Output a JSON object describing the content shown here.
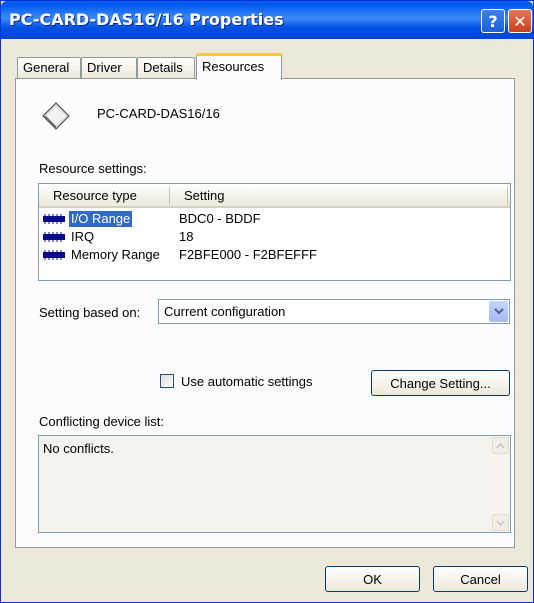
{
  "window": {
    "title": "PC-CARD-DAS16/16 Properties",
    "help_glyph": "?",
    "close_glyph": "✕"
  },
  "tabs": [
    {
      "label": "General",
      "active": false
    },
    {
      "label": "Driver",
      "active": false
    },
    {
      "label": "Details",
      "active": false
    },
    {
      "label": "Resources",
      "active": true
    }
  ],
  "device": {
    "name": "PC-CARD-DAS16/16",
    "icon": "pc-card-icon"
  },
  "resource_settings": {
    "label": "Resource settings:",
    "columns": [
      "Resource type",
      "Setting"
    ],
    "rows": [
      {
        "type": "I/O Range",
        "setting": "BDC0 - BDDF",
        "selected": true,
        "icon": "io-chip-icon"
      },
      {
        "type": "IRQ",
        "setting": "18",
        "selected": false,
        "icon": "irq-chip-icon"
      },
      {
        "type": "Memory Range",
        "setting": "F2BFE000 - F2BFEFFF",
        "selected": false,
        "icon": "memory-chip-icon"
      }
    ]
  },
  "setting_based_on": {
    "label": "Setting based on:",
    "value": "Current configuration"
  },
  "automatic": {
    "label": "Use automatic settings",
    "checked": false
  },
  "change_setting_label": "Change Setting...",
  "conflicts": {
    "label": "Conflicting device list:",
    "text": "No conflicts."
  },
  "buttons": {
    "ok": "OK",
    "cancel": "Cancel"
  },
  "colors": {
    "titlebar": "#0058ee",
    "selection": "#316ac5",
    "active_tab_accent": "#ffc83c"
  }
}
